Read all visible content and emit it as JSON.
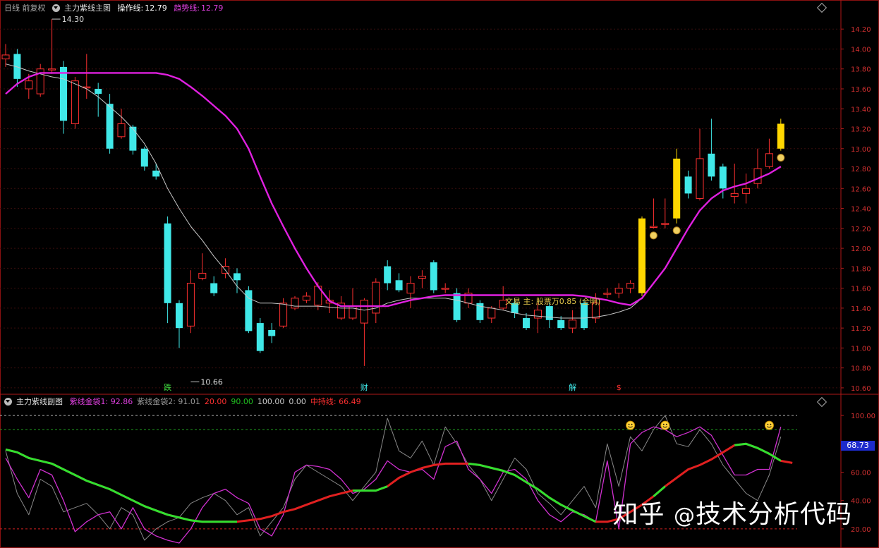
{
  "main_header": {
    "period": "日线 前复权",
    "indicator": "主力紫线主图",
    "op_label": "操作线:",
    "op_value": "12.79",
    "trend_label": "趋势线:",
    "trend_value": "12.79"
  },
  "sub_header": {
    "indicator": "主力紫线副图",
    "items": [
      {
        "text": "紫线金袋1: 92.86",
        "color": "#e040e0"
      },
      {
        "text": "紫线金袋2: 91.01",
        "color": "#999999"
      },
      {
        "text": "20.00",
        "color": "#ff3030"
      },
      {
        "text": "90.00",
        "color": "#20c020"
      },
      {
        "text": "100.00",
        "color": "#cccccc"
      },
      {
        "text": "0.00",
        "color": "#cccccc"
      },
      {
        "text": "中持线: 66.49",
        "color": "#ff3030"
      }
    ]
  },
  "annotation": "文易 主: 股票万0.85 (全明)",
  "watermark": {
    "prefix": "知乎",
    "at": "@",
    "name": "技术分析代码"
  },
  "sub_badge": "68.73",
  "chart_data": [
    {
      "type": "candlestick",
      "title": "主力紫线主图",
      "ylim": [
        10.55,
        14.35
      ],
      "yticks": [
        10.6,
        10.8,
        11.0,
        11.2,
        11.4,
        11.6,
        11.8,
        12.0,
        12.2,
        12.4,
        12.6,
        12.8,
        13.0,
        13.2,
        13.4,
        13.6,
        13.8,
        14.0,
        14.2
      ],
      "high_label": "14.30",
      "low_label": "10.66",
      "marker_labels": [
        "跌",
        "财",
        "解",
        "$"
      ],
      "marker_index": [
        14,
        31,
        49,
        53
      ],
      "candles": [
        [
          13.9,
          13.94,
          14.05,
          13.82
        ],
        [
          13.95,
          13.7,
          14.0,
          13.62
        ],
        [
          13.6,
          13.68,
          13.75,
          13.5
        ],
        [
          13.55,
          13.8,
          13.85,
          13.52
        ],
        [
          13.8,
          13.8,
          14.3,
          13.75
        ],
        [
          13.82,
          13.28,
          13.88,
          13.15
        ],
        [
          13.25,
          13.68,
          13.72,
          13.2
        ],
        [
          13.62,
          13.62,
          13.95,
          13.5
        ],
        [
          13.6,
          13.55,
          13.66,
          13.32
        ],
        [
          13.45,
          13.0,
          13.55,
          12.95
        ],
        [
          13.12,
          13.25,
          13.4,
          13.1
        ],
        [
          13.22,
          12.98,
          13.24,
          12.94
        ],
        [
          13.0,
          12.82,
          13.02,
          12.78
        ],
        [
          12.78,
          12.72,
          12.85,
          12.69
        ],
        [
          12.25,
          11.45,
          12.32,
          11.25
        ],
        [
          11.45,
          11.2,
          11.48,
          11.0
        ],
        [
          11.22,
          11.65,
          11.78,
          11.15
        ],
        [
          11.7,
          11.75,
          11.95,
          11.68
        ],
        [
          11.65,
          11.55,
          11.72,
          11.52
        ],
        [
          11.75,
          11.82,
          11.9,
          11.7
        ],
        [
          11.75,
          11.68,
          11.8,
          11.55
        ],
        [
          11.58,
          11.17,
          11.62,
          11.15
        ],
        [
          11.25,
          10.97,
          11.3,
          10.95
        ],
        [
          11.18,
          11.12,
          11.25,
          11.05
        ],
        [
          11.22,
          11.45,
          11.5,
          11.2
        ],
        [
          11.4,
          11.5,
          11.52,
          11.38
        ],
        [
          11.48,
          11.52,
          11.56,
          11.45
        ],
        [
          11.43,
          11.62,
          11.66,
          11.38
        ],
        [
          11.45,
          11.48,
          11.58,
          11.35
        ],
        [
          11.3,
          11.45,
          11.52,
          11.28
        ],
        [
          11.3,
          11.42,
          11.6,
          11.28
        ],
        [
          11.25,
          11.48,
          11.5,
          10.82
        ],
        [
          11.35,
          11.66,
          11.7,
          11.25
        ],
        [
          11.82,
          11.65,
          11.88,
          11.58
        ],
        [
          11.68,
          11.58,
          11.75,
          11.56
        ],
        [
          11.55,
          11.65,
          11.72,
          11.4
        ],
        [
          11.7,
          11.72,
          11.78,
          11.6
        ],
        [
          11.86,
          11.58,
          11.88,
          11.55
        ],
        [
          11.6,
          11.6,
          11.65,
          11.55
        ],
        [
          11.55,
          11.28,
          11.6,
          11.26
        ],
        [
          11.45,
          11.55,
          11.6,
          11.4
        ],
        [
          11.45,
          11.28,
          11.48,
          11.25
        ],
        [
          11.3,
          11.4,
          11.42,
          11.25
        ],
        [
          11.4,
          11.48,
          11.62,
          11.38
        ],
        [
          11.45,
          11.35,
          11.5,
          11.3
        ],
        [
          11.3,
          11.2,
          11.35,
          11.18
        ],
        [
          11.3,
          11.38,
          11.45,
          11.15
        ],
        [
          11.42,
          11.28,
          11.46,
          11.2
        ],
        [
          11.28,
          11.2,
          11.32,
          11.18
        ],
        [
          11.2,
          11.28,
          11.38,
          11.15
        ],
        [
          11.45,
          11.2,
          11.48,
          11.18
        ],
        [
          11.3,
          11.45,
          11.55,
          11.25
        ],
        [
          11.55,
          11.55,
          11.6,
          11.5
        ],
        [
          11.55,
          11.6,
          11.65,
          11.5
        ],
        [
          11.6,
          11.65,
          11.68,
          11.55
        ],
        [
          11.55,
          12.3,
          12.32,
          11.52
        ],
        [
          12.22,
          12.22,
          12.5,
          12.2
        ],
        [
          12.25,
          12.25,
          12.5,
          12.2
        ],
        [
          12.3,
          12.9,
          13.0,
          12.25
        ],
        [
          12.72,
          12.55,
          12.78,
          12.5
        ],
        [
          12.5,
          12.9,
          13.2,
          12.48
        ],
        [
          12.95,
          12.72,
          13.3,
          12.68
        ],
        [
          12.82,
          12.6,
          12.85,
          12.5
        ],
        [
          12.52,
          12.55,
          12.85,
          12.45
        ],
        [
          12.55,
          12.6,
          12.75,
          12.45
        ],
        [
          12.65,
          12.8,
          13.0,
          12.6
        ],
        [
          12.82,
          12.95,
          13.1,
          12.8
        ],
        [
          13.0,
          13.25,
          13.3,
          12.98
        ]
      ],
      "series": [
        {
          "name": "趋势线",
          "color": "#e020e0",
          "values": [
            13.55,
            13.65,
            13.72,
            13.76,
            13.76,
            13.76,
            13.76,
            13.76,
            13.76,
            13.76,
            13.76,
            13.76,
            13.76,
            13.76,
            13.74,
            13.7,
            13.62,
            13.53,
            13.43,
            13.33,
            13.2,
            13.0,
            12.72,
            12.45,
            12.22,
            12.0,
            11.8,
            11.62,
            11.47,
            11.42,
            11.42,
            11.42,
            11.42,
            11.42,
            11.45,
            11.48,
            11.5,
            11.52,
            11.53,
            11.53,
            11.53,
            11.53,
            11.53,
            11.53,
            11.53,
            11.53,
            11.53,
            11.53,
            11.53,
            11.53,
            11.52,
            11.5,
            11.48,
            11.45,
            11.43,
            11.5,
            11.65,
            11.8,
            12.0,
            12.2,
            12.38,
            12.5,
            12.58,
            12.62,
            12.65,
            12.7,
            12.75,
            12.82
          ]
        },
        {
          "name": "",
          "color": "#c8c8c8",
          "values": [
            13.85,
            13.82,
            13.78,
            13.75,
            13.72,
            13.7,
            13.65,
            13.6,
            13.52,
            13.42,
            13.32,
            13.2,
            13.05,
            12.85,
            12.6,
            12.4,
            12.22,
            12.08,
            11.92,
            11.78,
            11.62,
            11.5,
            11.45,
            11.45,
            11.44,
            11.42,
            11.42,
            11.42,
            11.41,
            11.4,
            11.4,
            11.38,
            11.4,
            11.45,
            11.48,
            11.5,
            11.5,
            11.5,
            11.5,
            11.48,
            11.45,
            11.42,
            11.4,
            11.38,
            11.35,
            11.33,
            11.32,
            11.31,
            11.3,
            11.3,
            11.3,
            11.31,
            11.33,
            11.36,
            11.4,
            11.5,
            11.65,
            11.8,
            12.0,
            12.2,
            12.38,
            12.5,
            12.58,
            12.62,
            12.65,
            12.7,
            12.75,
            12.82
          ]
        }
      ]
    },
    {
      "type": "line",
      "title": "主力紫线副图",
      "ylim": [
        10,
        108
      ],
      "yticks": [
        20,
        40,
        60,
        80,
        100
      ],
      "hlines": [
        {
          "value": 100,
          "color": "#aaaaaa"
        },
        {
          "value": 90,
          "color": "#20a020"
        },
        {
          "value": 20,
          "color": "#d02020"
        }
      ],
      "smiley_index": [
        54,
        57,
        66
      ],
      "series": [
        {
          "name": "紫线金袋1",
          "color": "#d030d0",
          "values": [
            70,
            55,
            42,
            62,
            58,
            40,
            18,
            25,
            30,
            32,
            20,
            35,
            20,
            15,
            12,
            10,
            20,
            35,
            45,
            48,
            42,
            38,
            20,
            15,
            30,
            60,
            65,
            64,
            62,
            55,
            45,
            48,
            55,
            68,
            62,
            60,
            62,
            55,
            78,
            82,
            62,
            55,
            45,
            60,
            62,
            55,
            40,
            30,
            25,
            32,
            30,
            25,
            68,
            20,
            80,
            88,
            92,
            90,
            85,
            88,
            92,
            86,
            72,
            58,
            58,
            62,
            62,
            92
          ]
        },
        {
          "name": "紫线金袋2",
          "color": "#888888",
          "values": [
            75,
            45,
            30,
            55,
            50,
            32,
            35,
            38,
            30,
            20,
            35,
            30,
            12,
            20,
            25,
            28,
            38,
            42,
            45,
            40,
            30,
            35,
            15,
            25,
            35,
            55,
            65,
            60,
            55,
            50,
            40,
            50,
            60,
            98,
            75,
            70,
            82,
            65,
            92,
            80,
            65,
            55,
            40,
            55,
            70,
            62,
            45,
            38,
            30,
            40,
            50,
            35,
            80,
            50,
            85,
            75,
            90,
            100,
            80,
            78,
            90,
            80,
            65,
            55,
            45,
            40,
            58,
            85
          ]
        },
        {
          "name": "中持线",
          "color": "#e02020",
          "smooth": true,
          "values": [
            76,
            74,
            70,
            68,
            66,
            62,
            58,
            54,
            51,
            48,
            44,
            40,
            36,
            33,
            30,
            28,
            26,
            25,
            25,
            25,
            25,
            26,
            27,
            29,
            32,
            34,
            37,
            40,
            43,
            45,
            47,
            47,
            47,
            50,
            56,
            60,
            63,
            65,
            66,
            66,
            66,
            65,
            63,
            61,
            58,
            53,
            48,
            42,
            37,
            33,
            29,
            25,
            25,
            27,
            32,
            37,
            43,
            50,
            56,
            62,
            65,
            69,
            74,
            79,
            80,
            77,
            73,
            68,
            66.49
          ]
        }
      ],
      "green_segments": [
        [
          0,
          20
        ],
        [
          30,
          33
        ],
        [
          40,
          51
        ],
        [
          56,
          57
        ],
        [
          63,
          67
        ]
      ]
    }
  ]
}
